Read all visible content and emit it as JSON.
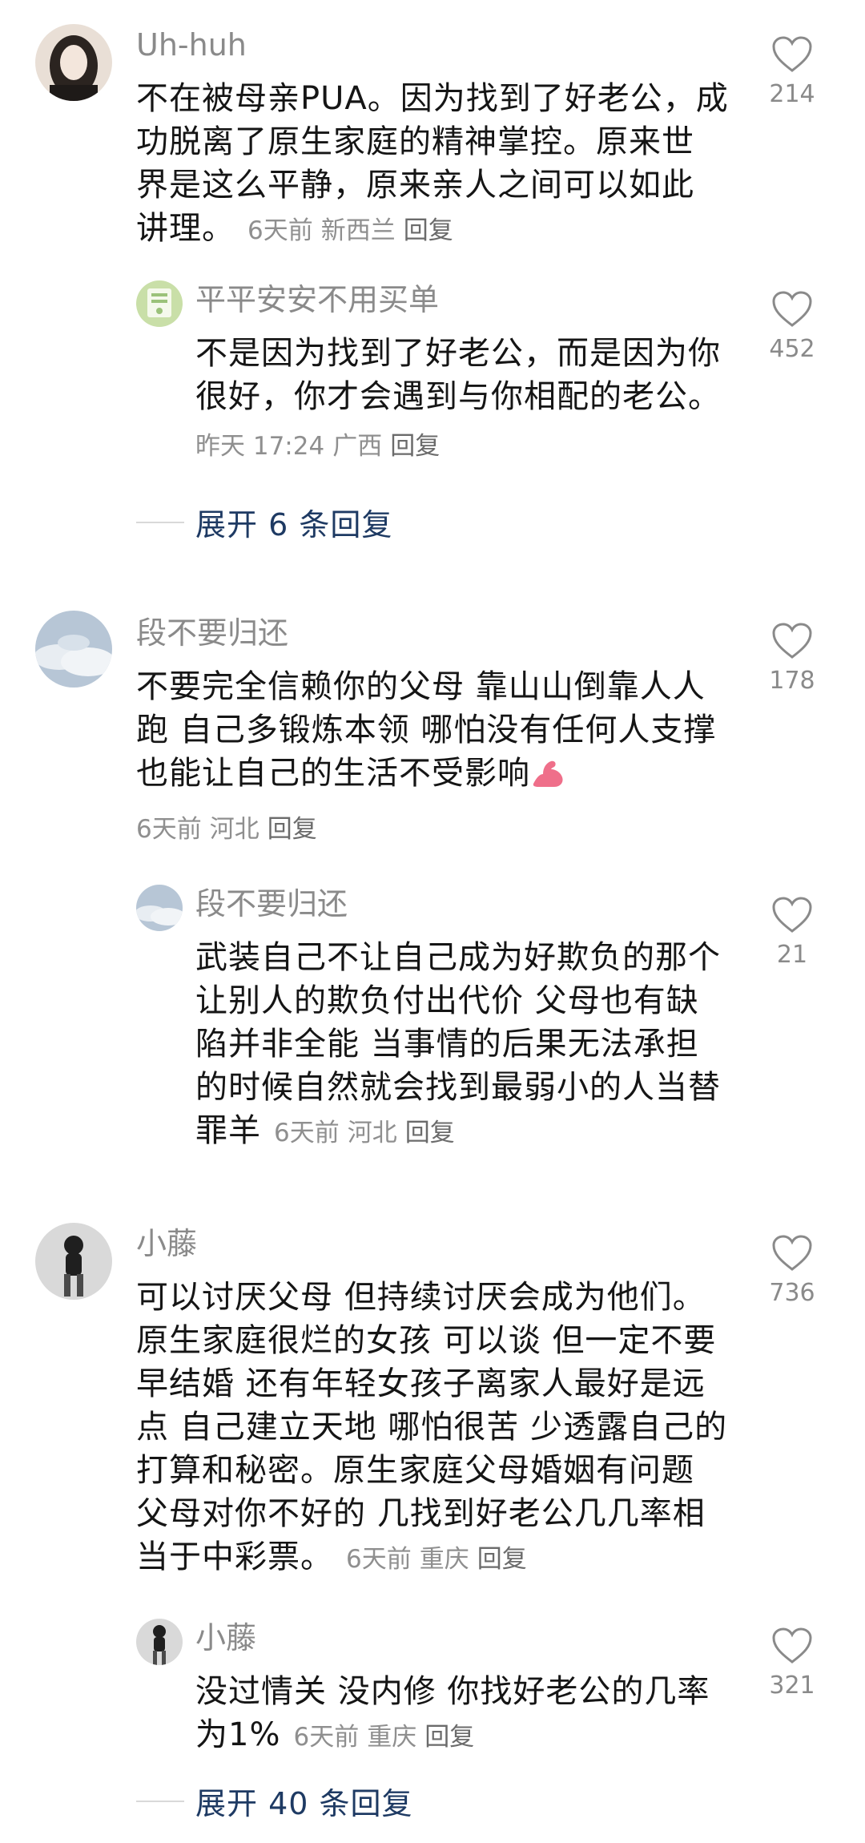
{
  "comments": [
    {
      "user": "Uh-huh",
      "text_lines": [
        "不在被母亲PUA。因为找到了好老公，成",
        "功脱离了原生家庭的精神掌控。原来世",
        "界是这么平静，原来亲人之间可以如此",
        "讲理。"
      ],
      "time": "6天前",
      "location": "新西兰",
      "reply_label": "回复",
      "likes": "214",
      "replies": [
        {
          "user": "平平安安不用买单",
          "text_lines": [
            "不是因为找到了好老公，而是因为你",
            "很好，你才会遇到与你相配的老公。"
          ],
          "time": "昨天 17:24",
          "location": "广西",
          "reply_label": "回复",
          "likes": "452"
        }
      ],
      "expand_label": "展开 6 条回复"
    },
    {
      "user": "段不要归还",
      "text_lines": [
        "不要完全信赖你的父母 靠山山倒靠人人",
        "跑 自己多锻炼本领 哪怕没有任何人支撑",
        "也能让自己的生活不受影响"
      ],
      "emoji": "flexed-biceps-icon",
      "time": "6天前",
      "location": "河北",
      "reply_label": "回复",
      "likes": "178",
      "replies": [
        {
          "user": "段不要归还",
          "text_lines": [
            "武装自己不让自己成为好欺负的那个",
            "让别人的欺负付出代价 父母也有缺",
            "陷并非全能 当事情的后果无法承担",
            "的时候自然就会找到最弱小的人当替",
            "罪羊"
          ],
          "time": "6天前",
          "location": "河北",
          "reply_label": "回复",
          "likes": "21"
        }
      ]
    },
    {
      "user": "小藤",
      "text_lines": [
        "可以讨厌父母 但持续讨厌会成为他们。",
        "原生家庭很烂的女孩 可以谈 但一定不要",
        "早结婚 还有年轻女孩子离家人最好是远",
        "点 自己建立天地 哪怕很苦 少透露自己的",
        "打算和秘密。原生家庭父母婚姻有问题",
        "父母对你不好的 几找到好老公几几率相",
        "当于中彩票。"
      ],
      "time": "6天前",
      "location": "重庆",
      "reply_label": "回复",
      "likes": "736",
      "replies": [
        {
          "user": "小藤",
          "text_lines": [
            "没过情关 没内修 你找好老公的几率",
            "为1%"
          ],
          "time": "6天前",
          "location": "重庆",
          "reply_label": "回复",
          "likes": "321"
        }
      ],
      "expand_label": "展开 40 条回复"
    }
  ],
  "colors": {
    "username": "#8a8a8a",
    "text": "#151515",
    "meta": "#8f8f8f",
    "expand": "#1e3a63"
  },
  "icons": {
    "like": "heart-outline-icon"
  }
}
